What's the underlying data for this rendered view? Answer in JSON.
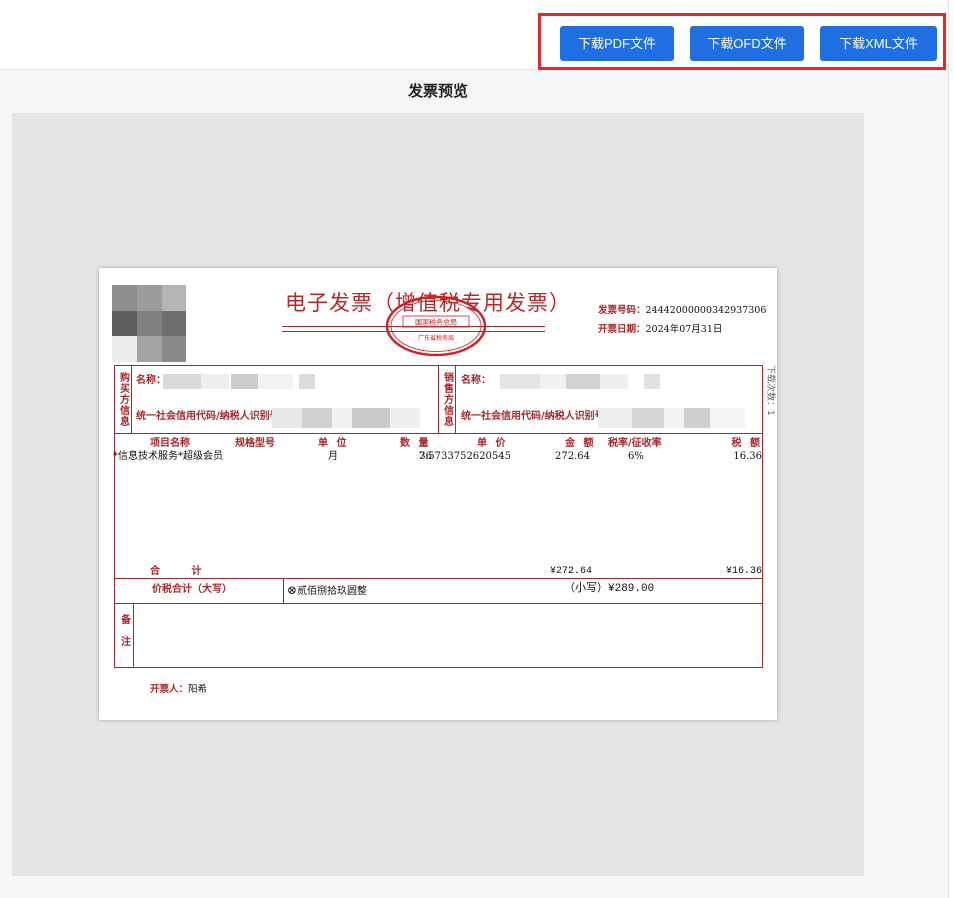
{
  "toolbar": {
    "buttons": {
      "pdf": "下载PDF文件",
      "ofd": "下载OFD文件",
      "xml": "下载XML文件"
    }
  },
  "preview": {
    "title": "发票预览"
  },
  "invoice": {
    "title": "电子发票（增值税专用发票）",
    "seal": {
      "line1": "国家税务总局",
      "line2": "广东省税务局"
    },
    "number_label": "发票号码：",
    "number": "24442000000342937306",
    "date_label": "开票日期：",
    "date": "2024年07月31日",
    "download_count": "下载次数：1",
    "buyer": {
      "section_label": "购买方信息",
      "name_label": "名称：",
      "tax_id_label": "统一社会信用代码/纳税人识别号："
    },
    "seller": {
      "section_label": "销售方信息",
      "name_label": "名称：",
      "tax_id_label": "统一社会信用代码/纳税人识别号："
    },
    "columns": {
      "name": "项目名称",
      "spec": "规格型号",
      "unit": "单 位",
      "quantity": "数 量",
      "price": "单 价",
      "amount": "金 额",
      "rate": "税率/征收率",
      "tax": "税 额"
    },
    "items": [
      {
        "name": "*信息技术服务*超级会员",
        "unit": "月",
        "quantity": "36",
        "price": "7.5733752620545",
        "amount": "272.64",
        "rate": "6%",
        "tax": "16.36"
      }
    ],
    "total": {
      "label": "合 计",
      "amount": "¥272.64",
      "tax": "¥16.36"
    },
    "grand_total": {
      "label": "价税合计（大写）",
      "words": "贰佰捌拾玖圆整",
      "figure": "（小写）¥289.00"
    },
    "remarks_label": "备注",
    "issuer": {
      "label": "开票人：",
      "name": "阳希"
    }
  },
  "colors": {
    "button": "#1f6fe3",
    "highlight": "#e8262d",
    "invoice_red": "#a8282b"
  },
  "icons": {
    "grand_total_prefix": "circle-x-icon"
  }
}
